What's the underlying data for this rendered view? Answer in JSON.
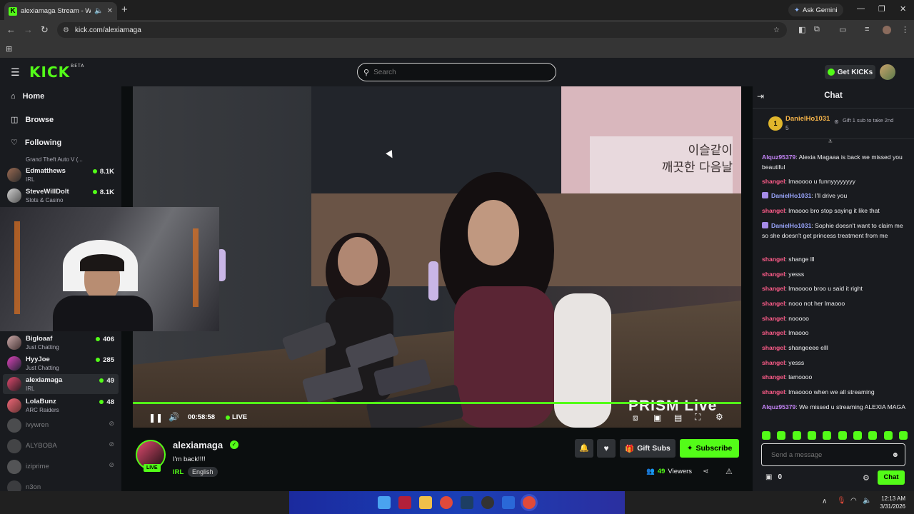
{
  "browser": {
    "tab_title": "alexiamaga Stream - Watch",
    "gemini_label": "Ask Gemini",
    "url": "kick.com/alexiamaga"
  },
  "site": {
    "logo_text": "KICK",
    "logo_badge": "BETA",
    "search_placeholder": "Search",
    "get_kicks_label": "Get KICKs"
  },
  "sidebar": {
    "nav": [
      {
        "label": "Home",
        "icon": "home-icon"
      },
      {
        "label": "Browse",
        "icon": "compass-icon"
      },
      {
        "label": "Following",
        "icon": "heart-icon"
      }
    ],
    "cut_category": "Grand Theft Auto V (...",
    "channels_top": [
      {
        "name": "Edmatthews",
        "category": "IRL",
        "viewers": "8.1K"
      },
      {
        "name": "SteveWillDoIt",
        "category": "Slots & Casino",
        "viewers": "8.1K"
      }
    ],
    "channels_live": [
      {
        "name": "Bigloaaf",
        "category": "Just Chatting",
        "viewers": "406"
      },
      {
        "name": "HyyJoe",
        "category": "Just Chatting",
        "viewers": "285"
      },
      {
        "name": "alexiamaga",
        "category": "IRL",
        "viewers": "49"
      },
      {
        "name": "LolaBunz",
        "category": "ARC Raiders",
        "viewers": "48"
      }
    ],
    "channels_offline": [
      "ivywren",
      "ALYBOBA",
      "iziprime",
      "n3on"
    ]
  },
  "video": {
    "overlay_text": "PRISM Live",
    "sign_text_line1": "이슬같이",
    "sign_text_line2": "깨끗한 다음날",
    "time": "00:58:58",
    "live_label": "LIVE",
    "progress": 1.0
  },
  "stream": {
    "streamer": "alexiamaga",
    "live_badge": "LIVE",
    "title": "I'm back!!!!",
    "category": "IRL",
    "language": "English",
    "viewers_count": "49",
    "viewers_label": "Viewers",
    "gift_subs_label": "Gift Subs",
    "subscribe_label": "Subscribe"
  },
  "chat": {
    "title": "Chat",
    "leader": {
      "rank": "1",
      "name": "DanielHo1031",
      "count": "5",
      "cta": "Gift 1 sub to take 2nd"
    },
    "messages": [
      {
        "user": "Alquz95379",
        "color": "#c485f7",
        "text": "Alexia Magaaa is back we missed you beautiful",
        "badge": false
      },
      {
        "user": "shangel",
        "color": "#ff5c8a",
        "text": "lmaoooo u funnyyyyyyyy",
        "badge": false
      },
      {
        "user": "DanielHo1031",
        "color": "#9ba7ff",
        "text": "I'll drive you",
        "badge": true
      },
      {
        "user": "shangel",
        "color": "#ff5c8a",
        "text": "lmaooo bro stop saying it like that",
        "badge": false
      },
      {
        "user": "DanielHo1031",
        "color": "#9ba7ff",
        "text": "Sophie doesn't want to claim me so she doesn't get princess treatment from me",
        "badge": true
      },
      {
        "user": "shangel",
        "color": "#ff5c8a",
        "text": "shange lll",
        "badge": false
      },
      {
        "user": "shangel",
        "color": "#ff5c8a",
        "text": "yesss",
        "badge": false
      },
      {
        "user": "shangel",
        "color": "#ff5c8a",
        "text": "lmaoooo broo u said it right",
        "badge": false
      },
      {
        "user": "shangel",
        "color": "#ff5c8a",
        "text": "nooo not her lmaooo",
        "badge": false
      },
      {
        "user": "shangel",
        "color": "#ff5c8a",
        "text": "nooooo",
        "badge": false
      },
      {
        "user": "shangel",
        "color": "#ff5c8a",
        "text": "lmaooo",
        "badge": false
      },
      {
        "user": "shangel",
        "color": "#ff5c8a",
        "text": "shangeeee elll",
        "badge": false
      },
      {
        "user": "shangel",
        "color": "#ff5c8a",
        "text": "yesss",
        "badge": false
      },
      {
        "user": "shangel",
        "color": "#ff5c8a",
        "text": "lamoooo",
        "badge": false
      },
      {
        "user": "shangel",
        "color": "#ff5c8a",
        "text": "lmaoooo when we all streaming",
        "badge": false
      },
      {
        "user": "Alquz95379",
        "color": "#c485f7",
        "text": "We missed u streaming ALEXIA MAGA",
        "badge": false
      }
    ],
    "input_placeholder": "Send a message",
    "points": "0",
    "send_label": "Chat"
  },
  "taskbar": {
    "time": "12:13 AM",
    "date": "3/31/2026"
  },
  "colors": {
    "accent": "#53fc18",
    "bg": "#0b0e0f",
    "panel": "#191b1f"
  }
}
